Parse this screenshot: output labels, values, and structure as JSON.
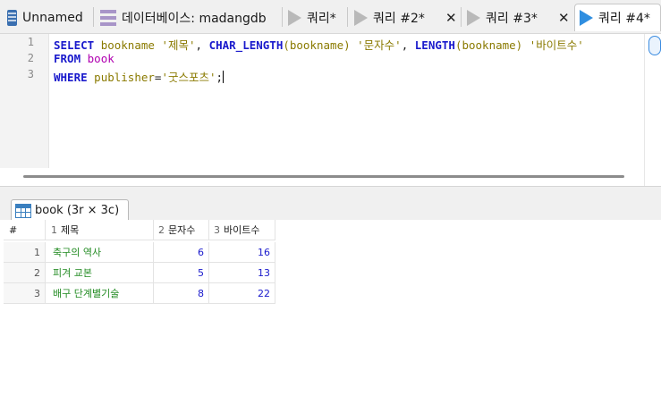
{
  "tabs": [
    {
      "label": "Unnamed",
      "icon": "database-icon"
    },
    {
      "label": "데이터베이스: madangdb",
      "icon": "schema-icon"
    },
    {
      "label": "쿼리*",
      "icon": "play-icon"
    },
    {
      "label": "쿼리 #2*",
      "icon": "play-icon"
    },
    {
      "label": "쿼리 #3*",
      "icon": "play-icon"
    },
    {
      "label": "쿼리 #4*",
      "icon": "play-icon-active"
    }
  ],
  "editor": {
    "line_numbers": [
      "1",
      "2",
      "3"
    ],
    "line1": {
      "kw_select": "SELECT",
      "col1": "bookname",
      "alias1": "'제목'",
      "comma1": ",",
      "fn1": "CHAR_LENGTH",
      "arg1": "(bookname)",
      "alias2": "'문자수'",
      "comma2": ",",
      "fn2": "LENGTH",
      "arg2": "(bookname)",
      "alias3": "'바이트수'"
    },
    "line2": {
      "kw_from": "FROM",
      "table": "book"
    },
    "line3": {
      "kw_where": "WHERE",
      "col": "publisher",
      "op": "=",
      "value": "'굿스포츠'",
      "semicolon": ";"
    }
  },
  "result_tab": {
    "label": "book (3r × 3c)"
  },
  "result": {
    "corner": "#",
    "columns": [
      {
        "num": "1",
        "name": "제목"
      },
      {
        "num": "2",
        "name": "문자수"
      },
      {
        "num": "3",
        "name": "바이트수"
      }
    ],
    "rows": [
      {
        "n": "1",
        "title": "축구의 역사",
        "chars": "6",
        "bytes": "16"
      },
      {
        "n": "2",
        "title": "피겨 교본",
        "chars": "5",
        "bytes": "13"
      },
      {
        "n": "3",
        "title": "배구 단계별기술",
        "chars": "8",
        "bytes": "22"
      }
    ]
  }
}
